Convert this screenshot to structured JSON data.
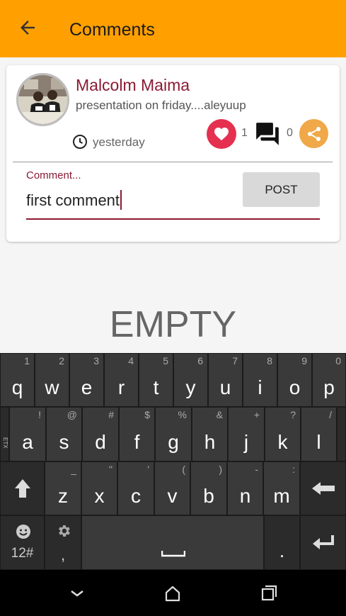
{
  "appbar": {
    "title": "Comments",
    "back_icon": "arrow-left-icon",
    "color": "#ffa000"
  },
  "post": {
    "author": "Malcolm Maima",
    "text": "presentation on friday....aleyuup",
    "time": "yesterday",
    "likes": "1",
    "comments": "0"
  },
  "comment_form": {
    "label": "Comment...",
    "value": "first comment",
    "post_label": "POST"
  },
  "empty_text": "EMPTY",
  "keyboard": {
    "row1": [
      {
        "k": "q",
        "h": "1"
      },
      {
        "k": "w",
        "h": "2"
      },
      {
        "k": "e",
        "h": "3"
      },
      {
        "k": "r",
        "h": "4"
      },
      {
        "k": "t",
        "h": "5"
      },
      {
        "k": "y",
        "h": "6"
      },
      {
        "k": "u",
        "h": "7"
      },
      {
        "k": "i",
        "h": "8"
      },
      {
        "k": "o",
        "h": "9"
      },
      {
        "k": "p",
        "h": "0"
      }
    ],
    "row2": [
      {
        "k": "a",
        "h": "!"
      },
      {
        "k": "s",
        "h": "@"
      },
      {
        "k": "d",
        "h": "#"
      },
      {
        "k": "f",
        "h": "$"
      },
      {
        "k": "g",
        "h": "%"
      },
      {
        "k": "h",
        "h": "&"
      },
      {
        "k": "j",
        "h": "+"
      },
      {
        "k": "k",
        "h": "?"
      },
      {
        "k": "l",
        "h": "/"
      }
    ],
    "row3": [
      {
        "k": "z",
        "h": "_"
      },
      {
        "k": "x",
        "h": "\""
      },
      {
        "k": "c",
        "h": "'"
      },
      {
        "k": "v",
        "h": "("
      },
      {
        "k": "b",
        "h": ")"
      },
      {
        "k": "n",
        "h": "-"
      },
      {
        "k": "m",
        "h": ":"
      }
    ],
    "symbols_label": "12#",
    "comma": ",",
    "period": ".",
    "side_label": "ETX"
  }
}
